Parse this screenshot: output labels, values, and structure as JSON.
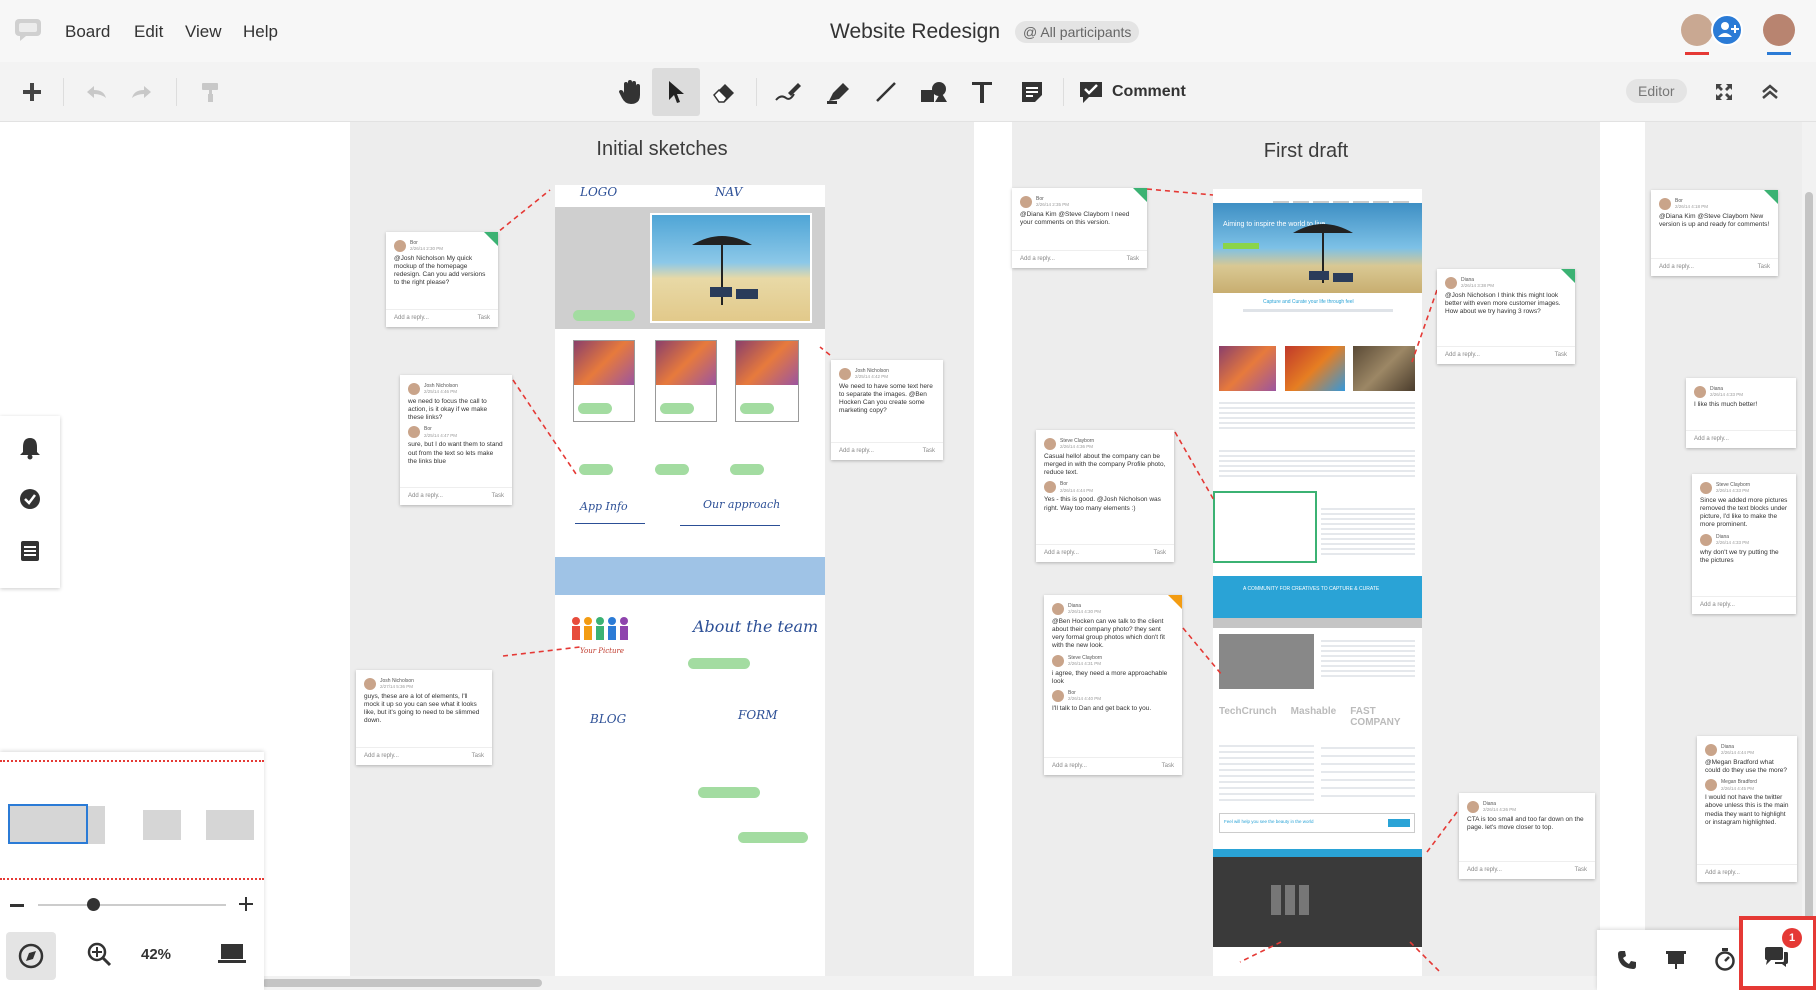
{
  "menubar": {
    "items": [
      "Board",
      "Edit",
      "View",
      "Help"
    ],
    "board_title": "Website Redesign",
    "participants_badge": "@ All participants"
  },
  "toolbar": {
    "comment_label": "Comment",
    "editor_label": "Editor"
  },
  "frames": [
    {
      "title": "Initial sketches"
    },
    {
      "title": "First draft"
    }
  ],
  "sketch_labels": {
    "logo": "LOGO",
    "nav": "NAV",
    "app_info": "App Info",
    "our_approach": "Our approach",
    "about_team": "About the team",
    "blog": "BLOG",
    "form": "FORM",
    "team_caption": "Your Picture"
  },
  "draft_page": {
    "hero_title": "Aiming to inspire the world to live",
    "sub_heading": "Capture and Curate your life through feel",
    "banner": "A COMMUNITY FOR CREATIVES TO CAPTURE & CURATE",
    "press": [
      "TechCrunch",
      "Mashable",
      "FAST COMPANY"
    ],
    "cta": "Feel will help you see the beauty in the world"
  },
  "cards": [
    {
      "author": "Bor",
      "date": "2/26/14 2:30 PM",
      "text": "@Josh Nicholson My quick mockup of the homepage redesign. Can you add versions to the right please?",
      "reply": "Add a reply...",
      "task": "Task"
    },
    {
      "author": "Josh Nicholson",
      "date": "2/25/14 4:46 PM",
      "text": "we need to focus the call to action, is it okay if we make these links?",
      "author2": "Bor",
      "date2": "2/25/14 4:47 PM",
      "text2": "sure, but I do want them to stand out from the text so lets make the links blue",
      "reply": "Add a reply...",
      "task": "Task"
    },
    {
      "author": "Josh Nicholson",
      "date": "2/25/14 4:42 PM",
      "text": "We need to have some text here to separate the images. @Ben Hocken Can you create some marketing copy?",
      "reply": "Add a reply...",
      "task": "Task"
    },
    {
      "author": "Josh Nicholson",
      "date": "2/27/14 5:36 PM",
      "text": "guys, these are a lot of elements, I'll mock it up so you can see what it looks like, but it's going to need to be slimmed down.",
      "reply": "Add a reply...",
      "task": "Task"
    },
    {
      "author": "Bor",
      "date": "2/26/14 2:35 PM",
      "text": "@Diana Kim @Steve Clayborn I need your comments on this version.",
      "reply": "Add a reply...",
      "task": "Task"
    },
    {
      "author": "Diana",
      "date": "2/26/14 3:38 PM",
      "text": "@Josh Nicholson I think this might look better with even more customer images. How about we try having 3 rows?",
      "reply": "Add a reply...",
      "task": "Task"
    },
    {
      "author": "Steve Clayborn",
      "date": "2/26/14 4:36 PM",
      "text": "Casual hello! about the company can be merged in with the company Profile photo, reduce text.",
      "author2": "Bor",
      "date2": "2/26/14 4:44 PM",
      "text2": "Yes - this is good. @Josh Nicholson was right. Way too many elements :)",
      "reply": "Add a reply...",
      "task": "Task"
    },
    {
      "author": "Diana",
      "date": "2/26/14 4:30 PM",
      "text": "@Ben Hocken can we talk to the client about their company photo? they sent very formal group photos which don't fit with the new look.",
      "author2": "Steve Clayborn",
      "date2": "2/26/14 4:31 PM",
      "text2": "i agree, they need a more approachable look",
      "author3": "Bor",
      "date3": "2/26/14 4:40 PM",
      "text3": "I'll talk to Dan and get back to you.",
      "reply": "Add a reply...",
      "task": "Task"
    },
    {
      "author": "Diana",
      "date": "2/26/14 4:26 PM",
      "text": "CTA is too small and too far down on the page. let's move closer to top.",
      "reply": "Add a reply...",
      "task": "Task"
    },
    {
      "author": "Bor",
      "date": "2/26/14 4:18 PM",
      "text": "@Diana Kim @Steve Clayborn New version is up and ready for comments!",
      "reply": "Add a reply...",
      "task": "Task"
    },
    {
      "author": "Diana",
      "date": "2/26/14 4:33 PM",
      "text": "I like this much better!",
      "reply": "Add a reply...",
      "task": ""
    },
    {
      "author": "Steve Clayborn",
      "date": "2/26/14 4:33 PM",
      "text": "Since we added more pictures removed the text blocks under picture, I'd like to make the more prominent.",
      "author2": "Diana",
      "date2": "2/26/14 4:33 PM",
      "text2": "why don't we try putting the the pictures",
      "reply": "Add a reply...",
      "task": ""
    },
    {
      "author": "Diana",
      "date": "2/26/14 4:44 PM",
      "text": "@Megan Bradford what could do they use the more?",
      "author2": "Megan Bradford",
      "date2": "2/26/14 4:45 PM",
      "text2": "I would not have the twitter above unless this is the main media they want to highlight or instagram highlighted.",
      "reply": "Add a reply...",
      "task": ""
    }
  ],
  "navigator": {
    "zoom": "42%"
  },
  "chat": {
    "badge_count": "1"
  },
  "colors": {
    "accent_red": "#e53935",
    "sketch_blue": "#2c4f96",
    "sketch_green": "#a3dca1",
    "draft_blue": "#2aa3d6",
    "tag_green": "#3bb273",
    "tag_orange": "#f39c12"
  }
}
